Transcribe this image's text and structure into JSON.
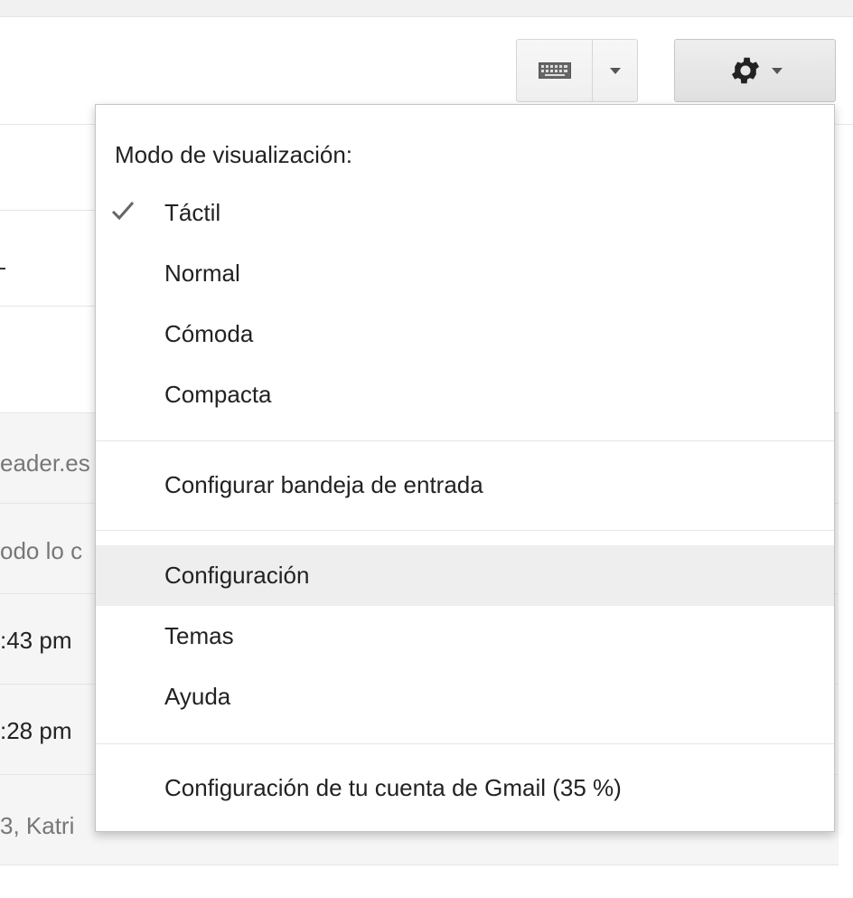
{
  "background": {
    "row_fragments": [
      "eader.es",
      "odo lo c",
      ":43 pm",
      ":28 pm",
      "3, Katri"
    ]
  },
  "toolbar": {
    "keyboard_icon": "keyboard-icon",
    "settings_icon": "gear-icon"
  },
  "menu": {
    "heading": "Modo de visualización:",
    "density_options": [
      {
        "label": "Táctil",
        "checked": true
      },
      {
        "label": "Normal",
        "checked": false
      },
      {
        "label": "Cómoda",
        "checked": false
      },
      {
        "label": "Compacta",
        "checked": false
      }
    ],
    "configure_inbox": "Configurar bandeja de entrada",
    "settings": "Configuración",
    "themes": "Temas",
    "help": "Ayuda",
    "account_settings": "Configuración de tu cuenta de Gmail (35 %)",
    "hovered_item": "Configuración"
  },
  "colors": {
    "hover_background": "#eeeeee",
    "checkmark": "#666666"
  }
}
